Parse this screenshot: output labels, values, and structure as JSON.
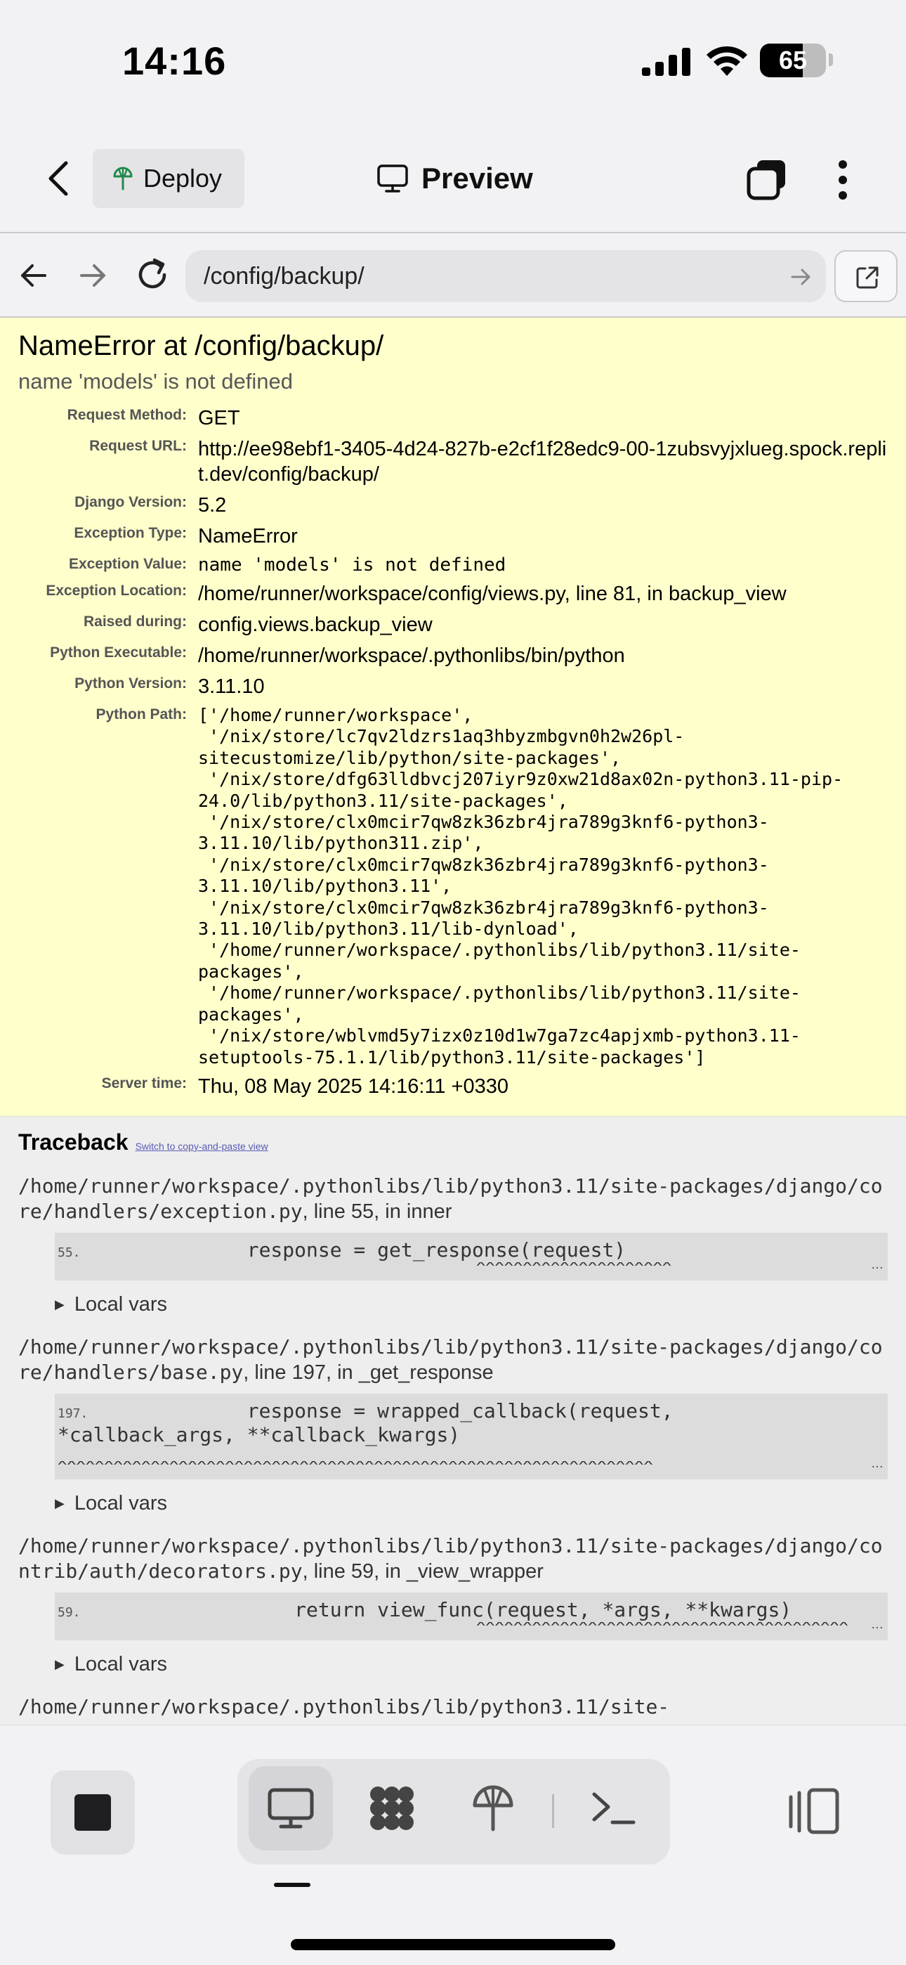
{
  "status_bar": {
    "time": "14:16",
    "battery_percent": "65",
    "battery_level": 0.65
  },
  "header": {
    "deploy_label": "Deploy",
    "preview_label": "Preview"
  },
  "browser": {
    "url": "/config/backup/"
  },
  "error": {
    "title": "NameError at /config/backup/",
    "subtitle": "name 'models' is not defined",
    "meta": [
      {
        "label": "Request Method:",
        "value": "GET"
      },
      {
        "label": "Request URL:",
        "value": "http://ee98ebf1-3405-4d24-827b-e2cf1f28edc9-00-1zubsvyjxlueg.spock.replit.dev/config/backup/"
      },
      {
        "label": "Django Version:",
        "value": "5.2"
      },
      {
        "label": "Exception Type:",
        "value": "NameError"
      },
      {
        "label": "Exception Value:",
        "value": "name 'models' is not defined"
      },
      {
        "label": "Exception Location:",
        "value": "/home/runner/workspace/config/views.py, line 81, in backup_view"
      },
      {
        "label": "Raised during:",
        "value": "config.views.backup_view"
      },
      {
        "label": "Python Executable:",
        "value": "/home/runner/workspace/.pythonlibs/bin/python"
      },
      {
        "label": "Python Version:",
        "value": "3.11.10"
      },
      {
        "label": "Python Path:",
        "value": "['/home/runner/workspace',\n '/nix/store/lc7qv2ldzrs1aq3hbyzmbgvn0h2w26pl-\nsitecustomize/lib/python/site-packages',\n '/nix/store/dfg63lldbvcj207iyr9z0xw21d8ax02n-python3.11-pip-\n24.0/lib/python3.11/site-packages',\n '/nix/store/clx0mcir7qw8zk36zbr4jra789g3knf6-python3-\n3.11.10/lib/python311.zip',\n '/nix/store/clx0mcir7qw8zk36zbr4jra789g3knf6-python3-\n3.11.10/lib/python3.11',\n '/nix/store/clx0mcir7qw8zk36zbr4jra789g3knf6-python3-\n3.11.10/lib/python3.11/lib-dynload',\n '/home/runner/workspace/.pythonlibs/lib/python3.11/site-\npackages',\n '/home/runner/workspace/.pythonlibs/lib/python3.11/site-\npackages',\n '/nix/store/wblvmd5y7izx0z10d1w7ga7zc4apjxmb-python3.11-\nsetuptools-75.1.1/lib/python3.11/site-packages']"
      },
      {
        "label": "Server time:",
        "value": "Thu, 08 May 2025 14:16:11 +0330"
      }
    ]
  },
  "traceback": {
    "title": "Traceback",
    "switch_link": "Switch to copy-and-paste view",
    "local_vars_label": "Local vars",
    "frames": [
      {
        "path": "/home/runner/workspace/.pythonlibs/lib/python3.11/site-packages/django/core/handlers/exception.py",
        "location": ", line 55, in inner",
        "lineno": "55.",
        "code": "                response = get_response(request)",
        "carets": "                                             ^^^^^^^^^^^^^^^^^^^^^"
      },
      {
        "path": "/home/runner/workspace/.pythonlibs/lib/python3.11/site-packages/django/core/handlers/base.py",
        "location": ", line 197, in _get_response",
        "lineno": "197.",
        "code": "                response = wrapped_callback(request,\n*callback_args, **callback_kwargs)",
        "carets": "^^^^^^^^^^^^^^^^^^^^^^^^^^^^^^^^^^^^^^^^^^^^^^^^^^^^^^^^^^^^^^^^"
      },
      {
        "path": "/home/runner/workspace/.pythonlibs/lib/python3.11/site-packages/django/contrib/auth/decorators.py",
        "location": ", line 59, in _view_wrapper",
        "lineno": "59.",
        "code": "                    return view_func(request, *args, **kwargs)",
        "carets": "                                             ^^^^^^^^^^^^^^^^^^^^^^^^^^^^^^^^^^^^^^^^"
      },
      {
        "path": "/home/runner/workspace/.pythonlibs/lib/python3.11/site-",
        "location": "",
        "lineno": "",
        "code": "",
        "carets": ""
      }
    ]
  }
}
